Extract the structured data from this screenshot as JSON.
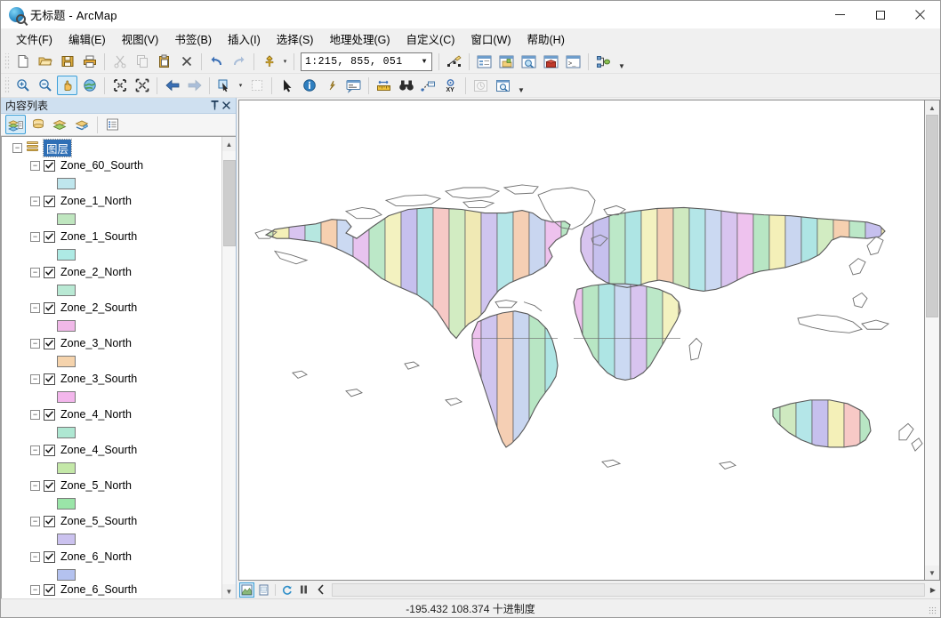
{
  "window": {
    "title": "无标题 - ArcMap",
    "app_icon": "arcmap-globe-icon",
    "minimize_label": "最小化",
    "maximize_label": "最大化",
    "close_label": "关闭"
  },
  "menubar": {
    "items": [
      {
        "label": "文件(F)",
        "name": "menu-file"
      },
      {
        "label": "编辑(E)",
        "name": "menu-edit"
      },
      {
        "label": "视图(V)",
        "name": "menu-view"
      },
      {
        "label": "书签(B)",
        "name": "menu-bookmarks"
      },
      {
        "label": "插入(I)",
        "name": "menu-insert"
      },
      {
        "label": "选择(S)",
        "name": "menu-selection"
      },
      {
        "label": "地理处理(G)",
        "name": "menu-geoprocessing"
      },
      {
        "label": "自定义(C)",
        "name": "menu-customize"
      },
      {
        "label": "窗口(W)",
        "name": "menu-window"
      },
      {
        "label": "帮助(H)",
        "name": "menu-help"
      }
    ]
  },
  "standard_toolbar": {
    "scale_value": "1:215, 855, 051",
    "scale_placeholder": "1:215, 855, 051",
    "buttons": [
      {
        "name": "new-document-icon",
        "tip": "新建文档"
      },
      {
        "name": "open-folder-icon",
        "tip": "打开"
      },
      {
        "name": "save-icon",
        "tip": "保存"
      },
      {
        "name": "print-icon",
        "tip": "打印"
      },
      {
        "name": "cut-icon",
        "tip": "剪切",
        "disabled": true
      },
      {
        "name": "copy-icon",
        "tip": "复制",
        "disabled": true
      },
      {
        "name": "paste-icon",
        "tip": "粘贴"
      },
      {
        "name": "delete-icon",
        "tip": "删除"
      },
      {
        "name": "undo-icon",
        "tip": "撤销"
      },
      {
        "name": "redo-icon",
        "tip": "重做",
        "disabled": true
      },
      {
        "name": "add-data-icon",
        "tip": "添加数据"
      },
      {
        "name": "editor-toolbar-icon",
        "tip": "编辑器工具条"
      },
      {
        "name": "table-of-contents-icon",
        "tip": "内容列表"
      },
      {
        "name": "catalog-window-icon",
        "tip": "目录窗口"
      },
      {
        "name": "search-window-icon",
        "tip": "搜索窗口"
      },
      {
        "name": "arctoolbox-icon",
        "tip": "ArcToolbox"
      },
      {
        "name": "python-window-icon",
        "tip": "Python 窗口"
      },
      {
        "name": "model-builder-icon",
        "tip": "ModelBuilder"
      }
    ]
  },
  "tools_toolbar": {
    "buttons": [
      {
        "name": "zoom-in-icon",
        "tip": "放大"
      },
      {
        "name": "zoom-out-icon",
        "tip": "缩小"
      },
      {
        "name": "pan-hand-icon",
        "tip": "平移",
        "active": true
      },
      {
        "name": "full-extent-globe-icon",
        "tip": "全图范围"
      },
      {
        "name": "fixed-zoom-in-icon",
        "tip": "固定放大"
      },
      {
        "name": "fixed-zoom-out-icon",
        "tip": "固定缩小"
      },
      {
        "name": "back-extent-icon",
        "tip": "返回上一视图"
      },
      {
        "name": "forward-extent-icon",
        "tip": "前进至下一视图",
        "disabled": true
      },
      {
        "name": "select-features-icon",
        "tip": "选择要素"
      },
      {
        "name": "clear-selection-icon",
        "tip": "清除所选要素",
        "disabled": true
      },
      {
        "name": "select-elements-icon",
        "tip": "选择元素"
      },
      {
        "name": "identify-icon",
        "tip": "识别"
      },
      {
        "name": "hyperlink-icon",
        "tip": "超链接"
      },
      {
        "name": "html-popup-icon",
        "tip": "HTML 弹出窗口"
      },
      {
        "name": "measure-icon",
        "tip": "测量"
      },
      {
        "name": "find-binoculars-icon",
        "tip": "查找"
      },
      {
        "name": "find-route-icon",
        "tip": "查找路径"
      },
      {
        "name": "go-to-xy-icon",
        "tip": "转到 XY"
      },
      {
        "name": "time-slider-icon",
        "tip": "时间滑块",
        "disabled": true
      },
      {
        "name": "create-viewer-window-icon",
        "tip": "创建查看器窗口"
      }
    ]
  },
  "toc": {
    "title": "内容列表",
    "pin_label": "自动隐藏",
    "close_label": "关闭",
    "mode_buttons": [
      {
        "name": "toc-list-by-drawing-order-icon",
        "tip": "按绘制顺序列出",
        "active": true
      },
      {
        "name": "toc-list-by-source-icon",
        "tip": "按源列出"
      },
      {
        "name": "toc-list-by-visibility-icon",
        "tip": "按可见性列出"
      },
      {
        "name": "toc-list-by-selection-icon",
        "tip": "按选择列出"
      },
      {
        "name": "toc-options-icon",
        "tip": "选项"
      }
    ],
    "root": {
      "label": "图层",
      "name": "toc-root-layers",
      "expanded": true,
      "selected": true
    },
    "layers": [
      {
        "label": "Zone_60_Sourth",
        "checked": true,
        "swatch": "#bfe6ed"
      },
      {
        "label": "Zone_1_North",
        "checked": true,
        "swatch": "#bfe6bf"
      },
      {
        "label": "Zone_1_Sourth",
        "checked": true,
        "swatch": "#aeeae4"
      },
      {
        "label": "Zone_2_North",
        "checked": true,
        "swatch": "#b9e9d4"
      },
      {
        "label": "Zone_2_Sourth",
        "checked": true,
        "swatch": "#f0b8e8"
      },
      {
        "label": "Zone_3_North",
        "checked": true,
        "swatch": "#f5d3ac"
      },
      {
        "label": "Zone_3_Sourth",
        "checked": true,
        "swatch": "#f3b6ec"
      },
      {
        "label": "Zone_4_North",
        "checked": true,
        "swatch": "#aee7d2"
      },
      {
        "label": "Zone_4_Sourth",
        "checked": true,
        "swatch": "#c4e8a8"
      },
      {
        "label": "Zone_5_North",
        "checked": true,
        "swatch": "#9ae5a8"
      },
      {
        "label": "Zone_5_Sourth",
        "checked": true,
        "swatch": "#cbc2ef"
      },
      {
        "label": "Zone_6_North",
        "checked": true,
        "swatch": "#b4c2ef"
      },
      {
        "label": "Zone_6_Sourth",
        "checked": true,
        "swatch": "#cde3b0"
      }
    ],
    "scrollbar": {
      "thumb_top_pct": 2,
      "thumb_height_pct": 20
    }
  },
  "map": {
    "background": "#ffffff",
    "outline_color": "#595959",
    "zone_stripe_colors": [
      "#cfe9c0",
      "#f4f0b8",
      "#d8c4ef",
      "#b6e7e0",
      "#f6d0b0",
      "#cbd9f2",
      "#e8c3ef",
      "#bce8c8",
      "#f3f2c0",
      "#c6c0ee",
      "#aee5e4",
      "#f7c9c6",
      "#d2ecc2",
      "#f0e9b4",
      "#cfc5ef",
      "#b4e6e8",
      "#f5cfb4",
      "#c9d6f0",
      "#eec2ee",
      "#b8e6c4"
    ],
    "bottom_buttons": [
      {
        "name": "data-view-button",
        "tip": "数据视图",
        "active": true
      },
      {
        "name": "layout-view-button",
        "tip": "布局视图"
      },
      {
        "name": "refresh-view-button",
        "tip": "刷新视图"
      },
      {
        "name": "pause-drawing-button",
        "tip": "暂停绘制"
      },
      {
        "name": "collapse-panel-button",
        "tip": "折叠"
      }
    ]
  },
  "statusbar": {
    "coordinates": "-195.432  108.374 十进制度",
    "resize_grip": "resize-grip-icon"
  }
}
